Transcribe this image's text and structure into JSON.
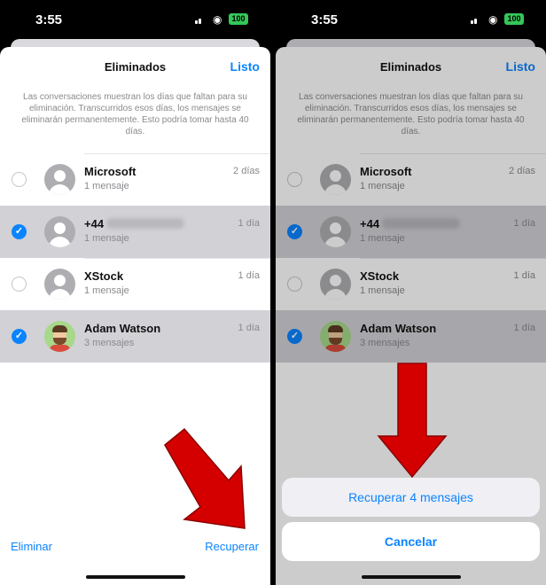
{
  "status": {
    "time": "3:55",
    "battery": "100"
  },
  "sheet": {
    "title": "Eliminados",
    "done": "Listo",
    "info": "Las conversaciones muestran los días que faltan para su eliminación. Transcurridos esos días, los mensajes se eliminarán permanentemente. Esto podría tomar hasta 40 días."
  },
  "rows": [
    {
      "name": "Microsoft",
      "sub": "1 mensaje",
      "days": "2 días",
      "selected": false
    },
    {
      "name": "+44",
      "sub": "1 mensaje",
      "days": "1 día",
      "selected": true
    },
    {
      "name": "XStock",
      "sub": "1 mensaje",
      "days": "1 día",
      "selected": false
    },
    {
      "name": "Adam Watson",
      "sub": "3 mensajes",
      "days": "1 día",
      "selected": true
    }
  ],
  "toolbar": {
    "delete": "Eliminar",
    "recover": "Recuperar"
  },
  "actions": {
    "recover": "Recuperar 4 mensajes",
    "cancel": "Cancelar"
  },
  "colors": {
    "accent": "#0a84ff",
    "selected_row": "#d1d1d6",
    "arrow": "#d40000"
  },
  "icons": {
    "checkmark": "checkmark-icon",
    "person": "person-icon"
  }
}
